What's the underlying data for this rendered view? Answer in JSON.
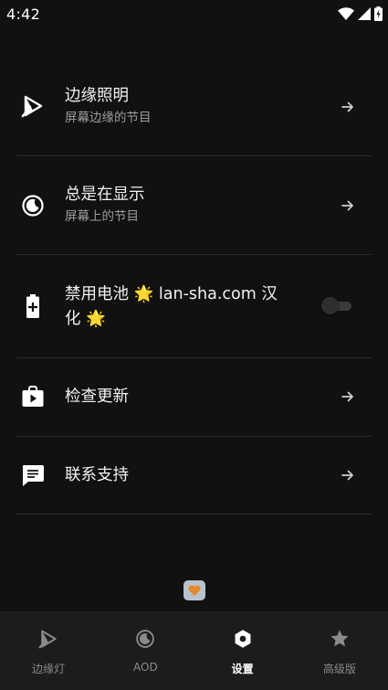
{
  "status_bar": {
    "time": "4:42",
    "icons": [
      "wifi-icon",
      "signal-icon",
      "battery-charging-icon"
    ]
  },
  "settings": [
    {
      "icon": "edge-lighting-icon",
      "title": "边缘照明",
      "subtitle": "屏幕边缘的节目",
      "control": "arrow"
    },
    {
      "icon": "always-on-display-icon",
      "title": "总是在显示",
      "subtitle": "屏幕上的节目",
      "control": "arrow"
    },
    {
      "icon": "battery-icon",
      "title_line1": "禁用电池 🌟 lan-sha.com 汉",
      "title_line2": "化 🌟",
      "control": "toggle",
      "toggle_on": false
    },
    {
      "icon": "update-bag-icon",
      "title": "检查更新",
      "control": "arrow"
    },
    {
      "icon": "chat-support-icon",
      "title": "联系支持",
      "control": "arrow"
    }
  ],
  "floating_chip": {
    "icon": "heart-icon",
    "color": "#e58a2e"
  },
  "bottom_nav": {
    "items": [
      {
        "label": "边缘灯",
        "icon": "edge-lighting-icon",
        "active": false
      },
      {
        "label": "AOD",
        "icon": "always-on-display-icon",
        "active": false
      },
      {
        "label": "设置",
        "icon": "settings-icon",
        "active": true
      },
      {
        "label": "高级版",
        "icon": "star-icon",
        "active": false
      }
    ]
  },
  "colors": {
    "background": "#111111",
    "nav_background": "#1c1c1c",
    "text_primary": "#f2f2f2",
    "text_secondary": "#9e9e9e",
    "divider": "#2a2a2a"
  }
}
